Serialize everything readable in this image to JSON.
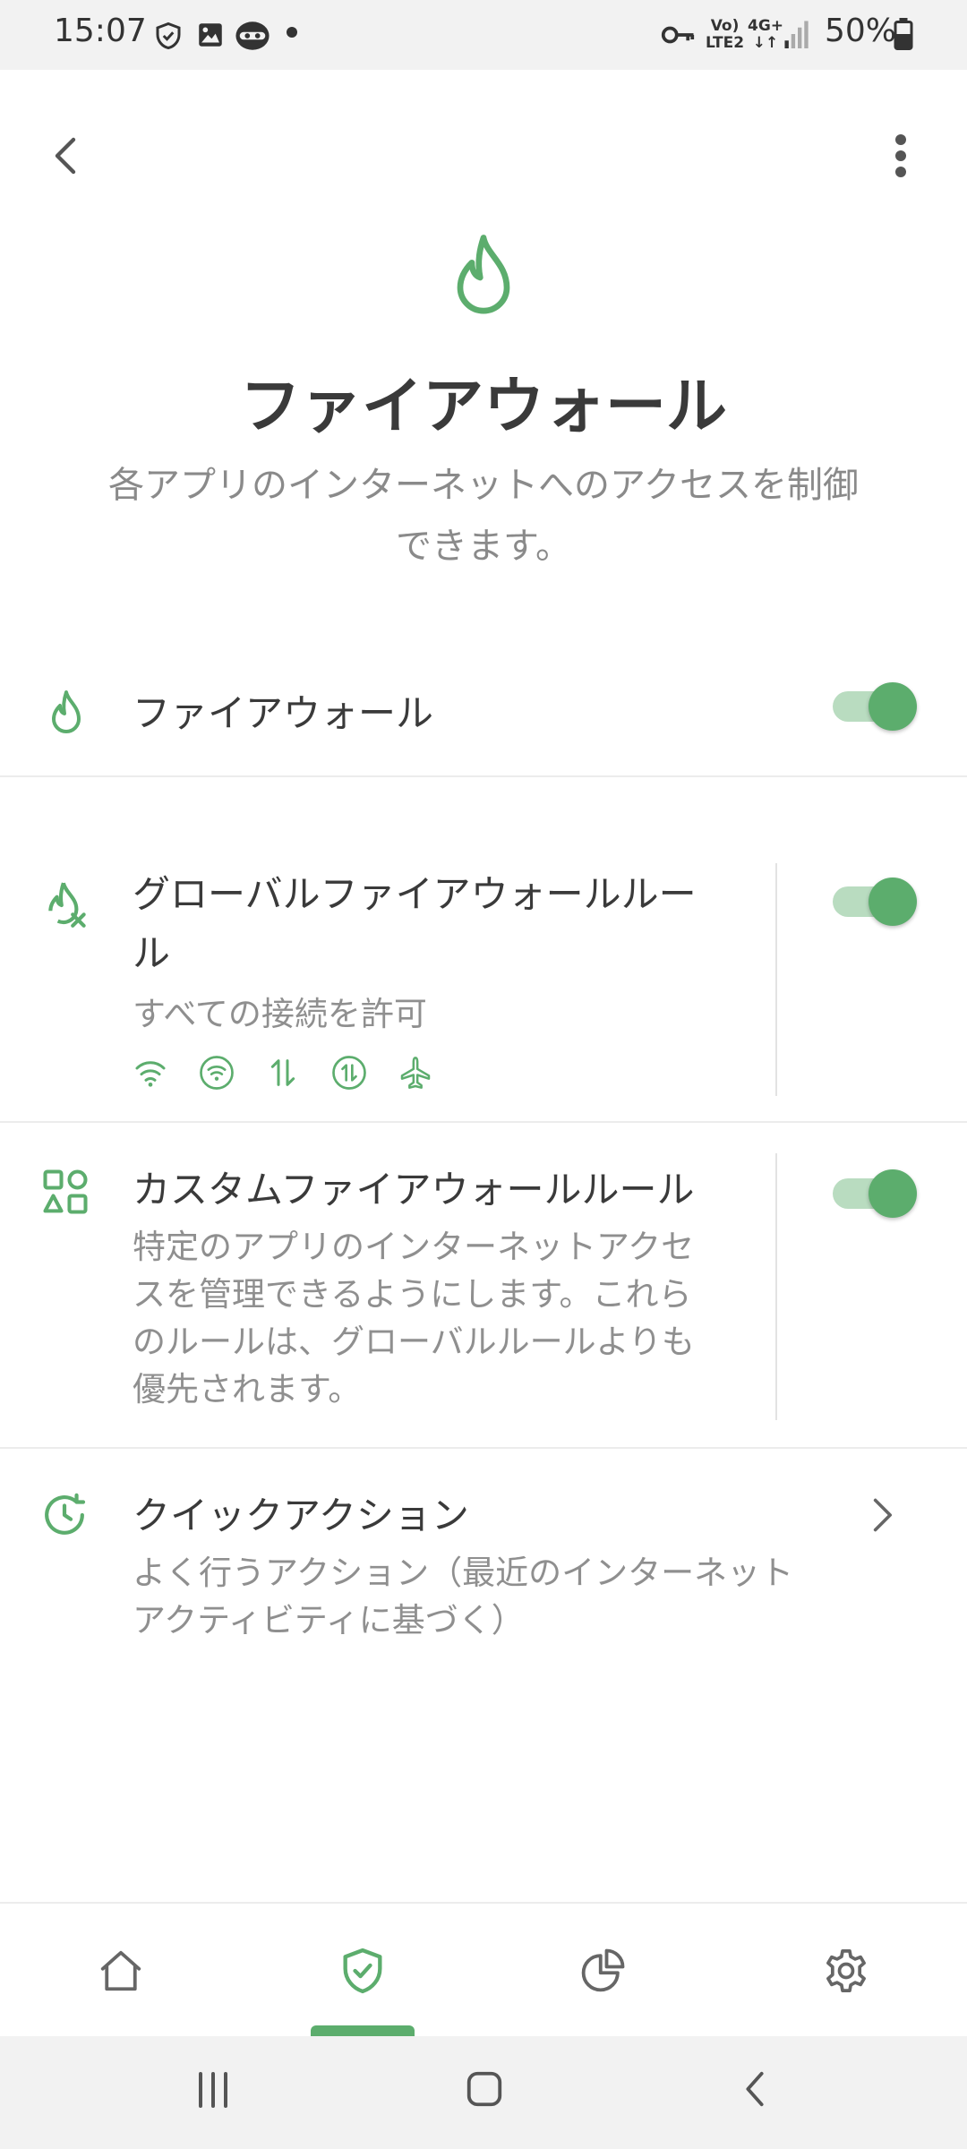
{
  "status_bar": {
    "time": "15:07",
    "battery": "50%",
    "net_label_1": "Vo)",
    "net_label_2": "LTE2",
    "net_label_3": "4G+",
    "icons": [
      "shield-icon",
      "image-icon",
      "ninja-icon",
      "dot-icon",
      "key-icon",
      "signal-icon",
      "battery-icon"
    ]
  },
  "app_bar": {
    "back_icon": "back-arrow-icon",
    "menu_icon": "more-vert-icon"
  },
  "hero": {
    "icon": "flame-icon",
    "title": "ファイアウォール",
    "description_line1": "各アプリのインターネットへのアクセスを制御",
    "description_line2": "できます。"
  },
  "rows": {
    "firewall": {
      "icon": "flame-icon",
      "title": "ファイアウォール",
      "enabled": true
    },
    "global_rule": {
      "icon": "flame-x-icon",
      "title_line1": "グローバルファイアウォールルー",
      "title_line2": "ル",
      "subtitle": "すべての接続を許可",
      "connection_icons": [
        "wifi-icon",
        "wifi-circle-icon",
        "mobile-data-icon",
        "mobile-data-circle-icon",
        "airplane-icon"
      ],
      "enabled": true
    },
    "custom_rule": {
      "icon": "apps-shapes-icon",
      "title": "カスタムファイアウォールルール",
      "subtitle_lines": [
        "特定のアプリのインターネットアクセ",
        "スを管理できるようにします。これら",
        "のルールは、グローバルルールよりも",
        "優先されます。"
      ],
      "enabled": true
    },
    "quick_actions": {
      "icon": "clock-refresh-icon",
      "title": "クイックアクション",
      "subtitle_lines": [
        "よく行うアクション（最近のインターネット",
        "アクティビティに基づく）"
      ]
    }
  },
  "bottom_nav": {
    "items": [
      "home-icon",
      "shield-check-icon",
      "pie-chart-icon",
      "gear-icon"
    ],
    "selected_index": 1
  },
  "colors": {
    "accent": "#5cad6d",
    "accent_light": "#b9dcc0",
    "text": "#3a3a3a",
    "secondary": "#8f8f8f"
  }
}
